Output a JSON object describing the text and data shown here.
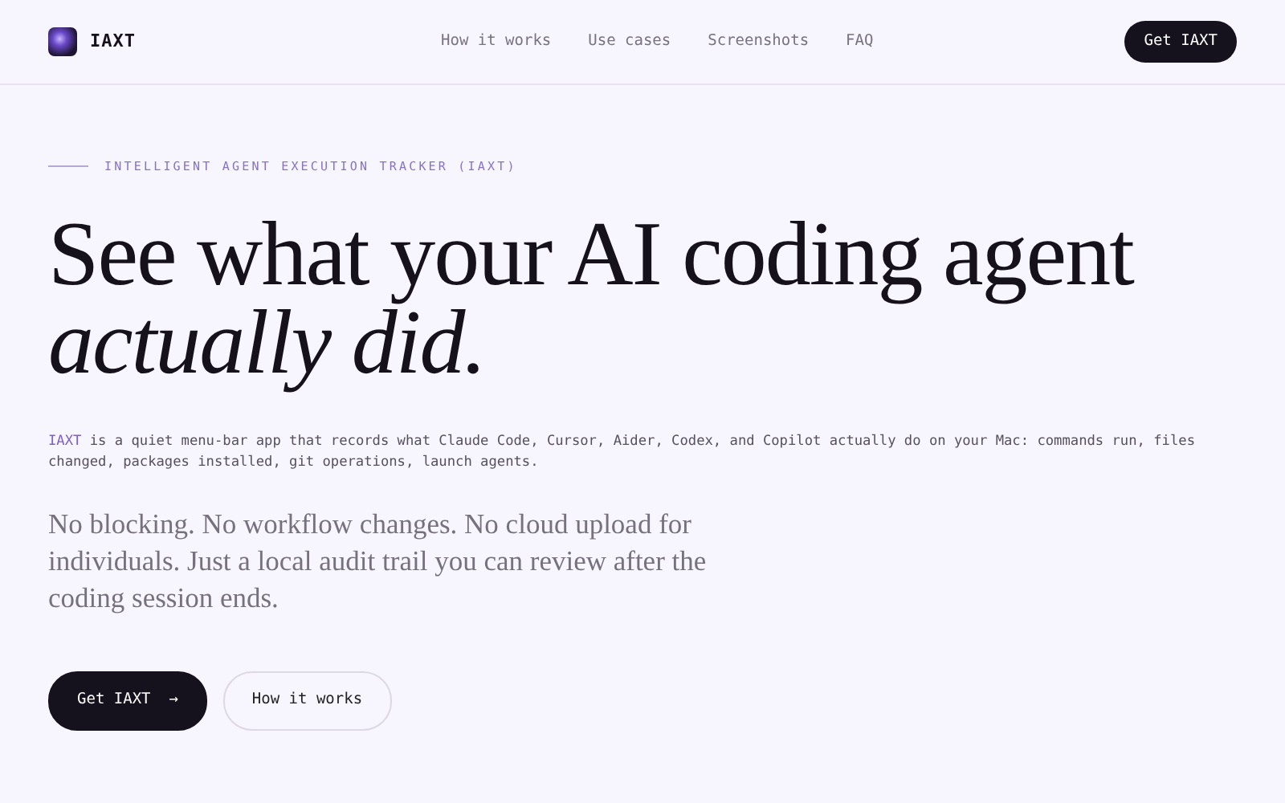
{
  "brand": {
    "name": "IAXT"
  },
  "nav": [
    {
      "label": "How it works"
    },
    {
      "label": "Use cases"
    },
    {
      "label": "Screenshots"
    },
    {
      "label": "FAQ"
    }
  ],
  "header_button": "Get IAXT",
  "hero": {
    "eyebrow": "INTELLIGENT AGENT EXECUTION TRACKER (IAXT)",
    "headline": "See what your AI coding agent *actually did.*",
    "intro_brand": "IAXT",
    "intro_text": " is a quiet menu-bar app that records what Claude Code, Cursor, Aider, Codex, and Copilot actually do on your Mac: commands run, files changed, packages installed, git operations, launch agents.",
    "lead": "No blocking. No workflow changes. No cloud upload for individuals. Just a local audit trail you can review after the coding session ends.",
    "buttons": [
      {
        "label": "Get IAXT",
        "arrow": "→",
        "kind": "primary"
      },
      {
        "label": "How it works",
        "kind": "outline"
      }
    ]
  }
}
